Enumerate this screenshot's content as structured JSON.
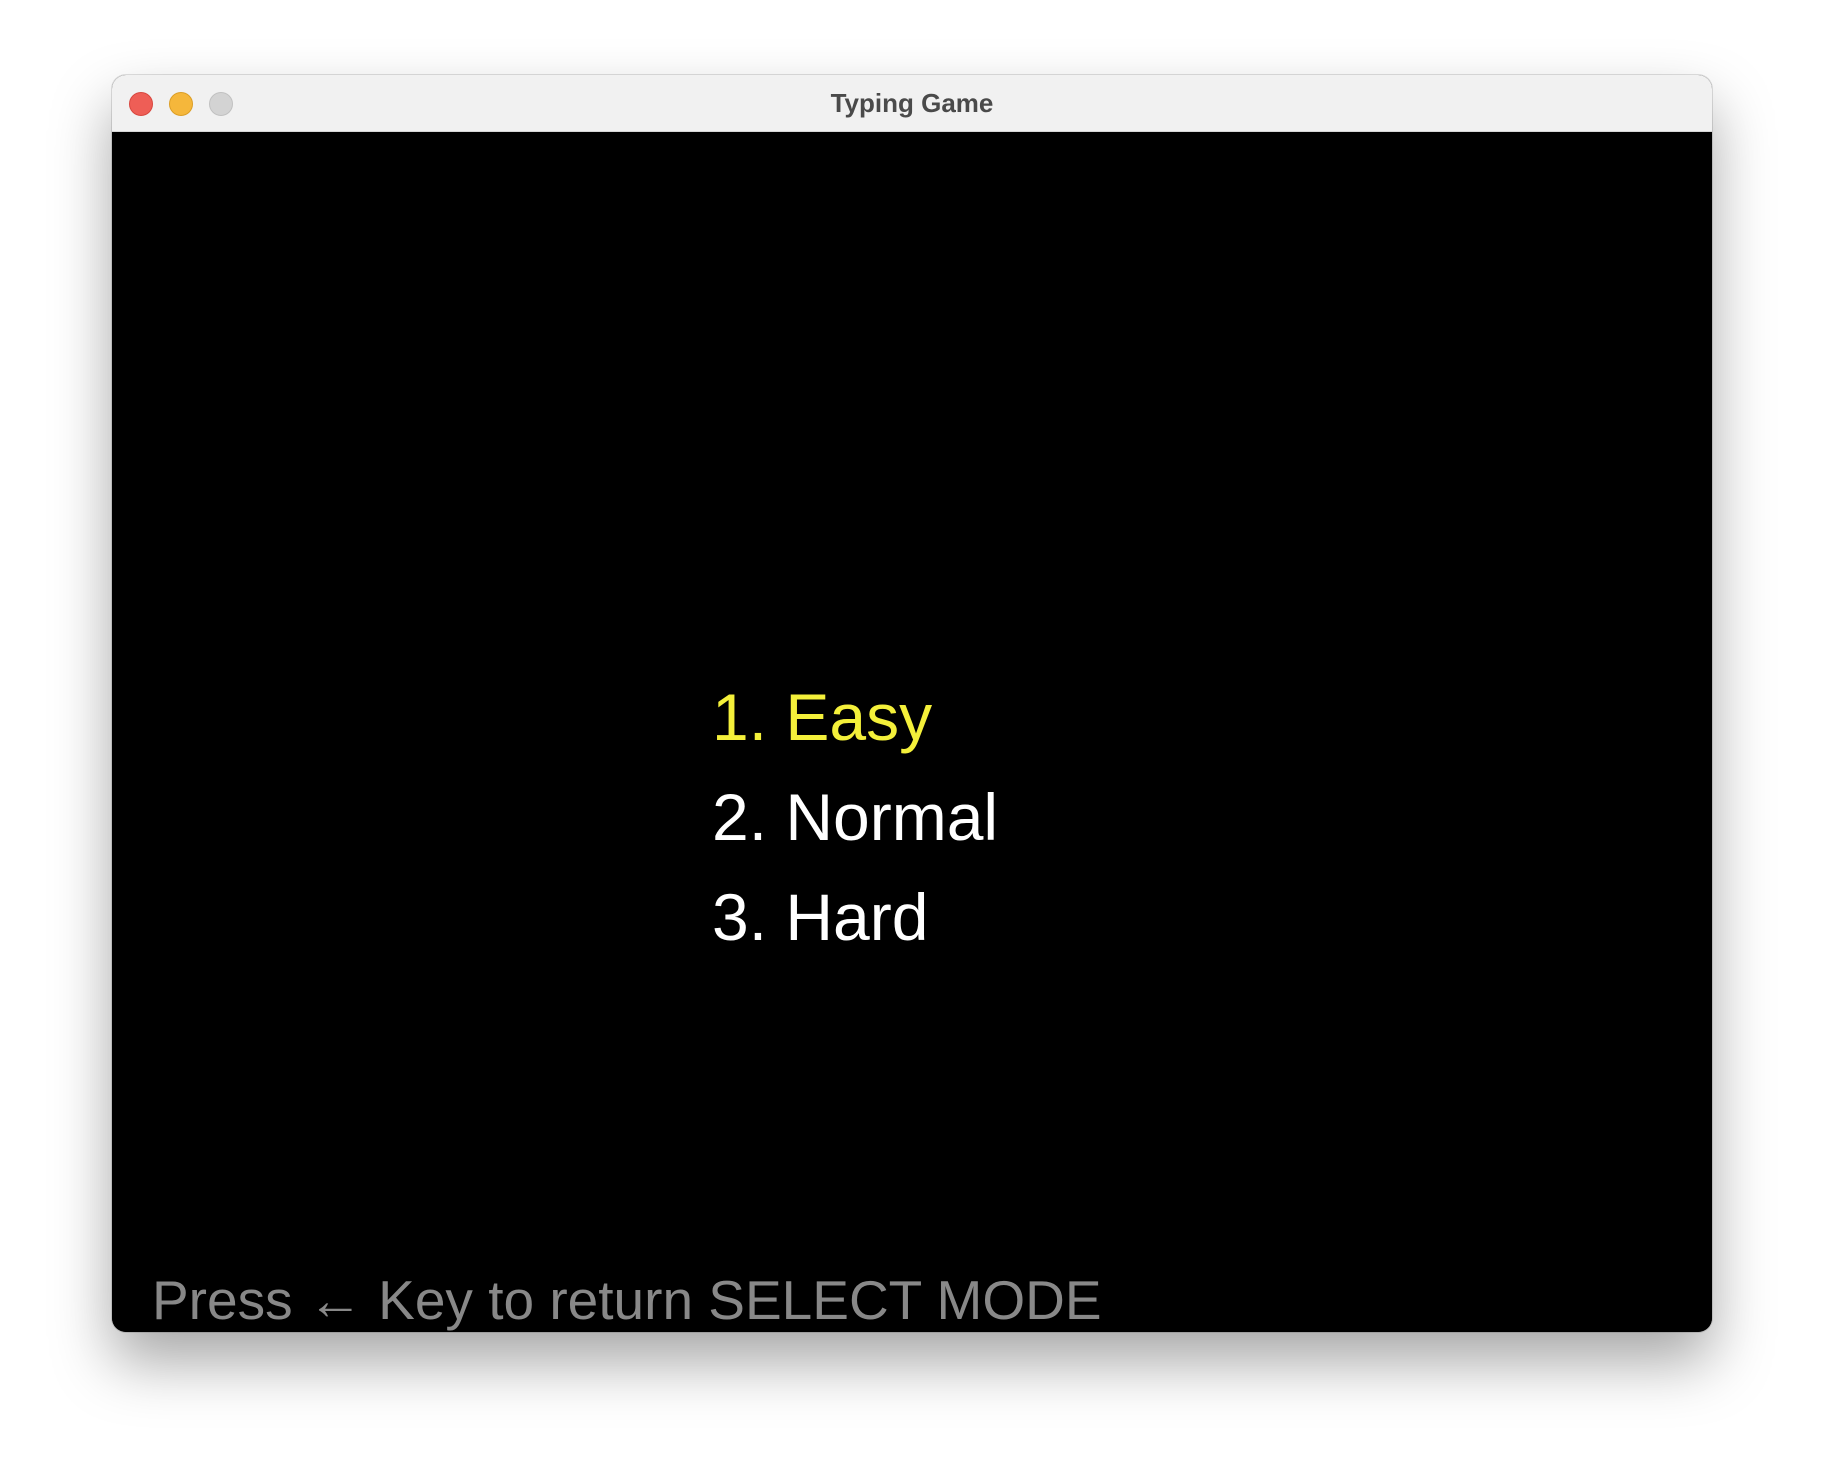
{
  "window": {
    "title": "Typing Game"
  },
  "menu": {
    "items": [
      {
        "label": "1. Easy",
        "selected": true
      },
      {
        "label": "2. Normal",
        "selected": false
      },
      {
        "label": "3. Hard",
        "selected": false
      }
    ]
  },
  "footer": {
    "hint": "Press ← Key to return SELECT MODE"
  },
  "colors": {
    "selected": "#f4f03a",
    "unselected": "#ffffff",
    "hint": "#888888",
    "background": "#000000"
  }
}
